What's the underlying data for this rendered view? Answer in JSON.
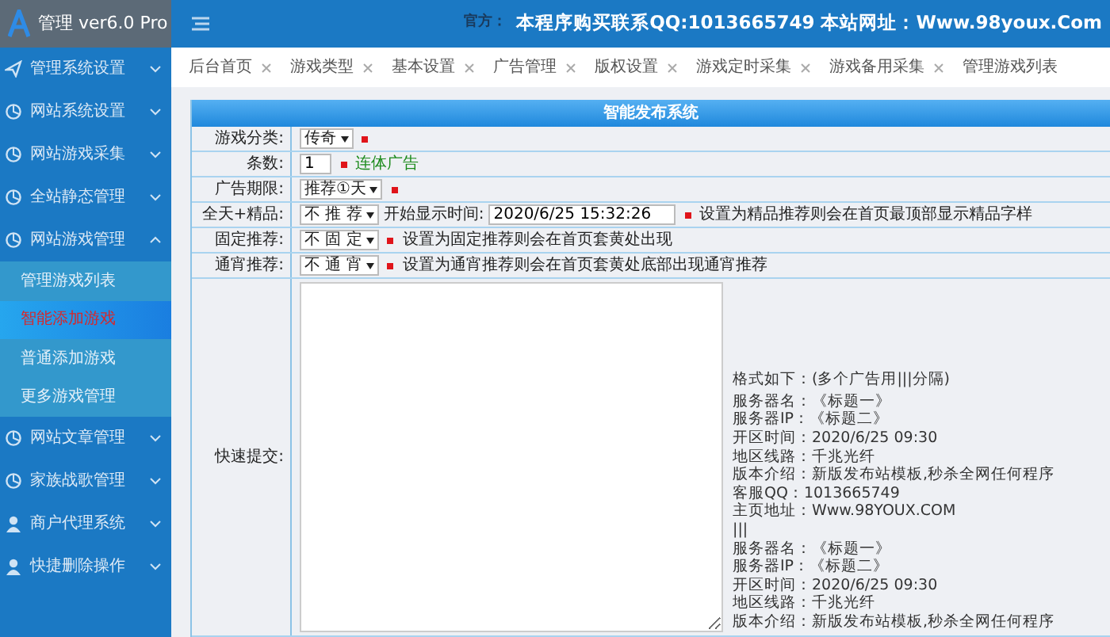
{
  "brand": {
    "title": "管理 ver6.0 Pro"
  },
  "header": {
    "label": "官方：",
    "notice": "本程序购买联系QQ:1013665749 本站网址：Www.98youx.Com"
  },
  "sidebar": {
    "items": [
      {
        "label": "管理系统设置",
        "kind": "plane",
        "expanded": false
      },
      {
        "label": "网站系统设置",
        "kind": "circle",
        "expanded": false
      },
      {
        "label": "网站游戏采集",
        "kind": "circle",
        "expanded": false
      },
      {
        "label": "全站静态管理",
        "kind": "circle",
        "expanded": false
      },
      {
        "label": "网站游戏管理",
        "kind": "circle",
        "expanded": true,
        "children": [
          {
            "label": "管理游戏列表",
            "selected": false
          },
          {
            "label": "智能添加游戏",
            "selected": true
          },
          {
            "label": "普通添加游戏",
            "selected": false
          },
          {
            "label": "更多游戏管理",
            "selected": false
          }
        ]
      },
      {
        "label": "网站文章管理",
        "kind": "circle",
        "expanded": false
      },
      {
        "label": "家族战歌管理",
        "kind": "circle",
        "expanded": false
      },
      {
        "label": "商户代理系统",
        "kind": "user",
        "expanded": false
      },
      {
        "label": "快捷删除操作",
        "kind": "user",
        "expanded": false
      }
    ]
  },
  "tabs": [
    {
      "label": "后台首页",
      "closable": true
    },
    {
      "label": "游戏类型",
      "closable": true
    },
    {
      "label": "基本设置",
      "closable": true
    },
    {
      "label": "广告管理",
      "closable": true
    },
    {
      "label": "版权设置",
      "closable": true
    },
    {
      "label": "游戏定时采集",
      "closable": true
    },
    {
      "label": "游戏备用采集",
      "closable": true
    },
    {
      "label": "管理游戏列表",
      "closable": false
    }
  ],
  "form": {
    "title": "智能发布系统",
    "rows": [
      {
        "label": "游戏分类:",
        "kind": "select",
        "value": "传奇",
        "required": true
      },
      {
        "label": "条数:",
        "kind": "input",
        "value": "1",
        "required": true,
        "note": "连体广告"
      },
      {
        "label": "广告期限:",
        "kind": "select",
        "value": "推荐①天",
        "required": true
      },
      {
        "label": "全天+精品:",
        "kind": "select",
        "value": "不 推 荐",
        "extra_label": "开始显示时间:",
        "extra_value": "2020/6/25 15:32:26",
        "required": true,
        "hint": "设置为精品推荐则会在首页最顶部显示精品字样"
      },
      {
        "label": "固定推荐:",
        "kind": "select",
        "value": "不 固 定",
        "required": true,
        "hint": "设置为固定推荐则会在首页套黄处出现"
      },
      {
        "label": "通宵推荐:",
        "kind": "select",
        "value": "不 通 宵",
        "required": true,
        "hint": "设置为通宵推荐则会在首页套黄处底部出现通宵推荐"
      },
      {
        "label": "快速提交:",
        "kind": "textarea",
        "help_title": "格式如下：(多个广告用|||分隔)",
        "help_lines": [
          "服务器名：《标题一》",
          "服务器IP：《标题二》",
          "开区时间：2020/6/25 09:30",
          "地区线路：千兆光纤",
          "版本介绍：新版发布站模板,秒杀全网任何程序",
          "客服QQ：1013665749",
          "主页地址：Www.98YOUX.COM",
          "|||",
          "服务器名：《标题一》",
          "服务器IP：《标题二》",
          "开区时间：2020/6/25 09:30",
          "地区线路：千兆光纤",
          "版本介绍：新版发布站模板,秒杀全网任何程序"
        ]
      }
    ]
  }
}
